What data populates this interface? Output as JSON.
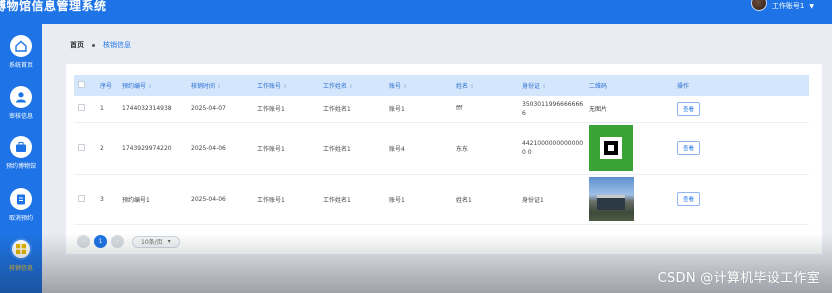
{
  "header": {
    "title": "博物馆信息管理系统",
    "user_label": "工作账号1",
    "user_caret": "▼"
  },
  "sidebar": {
    "items": [
      {
        "label": "系统首页",
        "icon": "home-icon"
      },
      {
        "label": "审核信息",
        "icon": "user-icon"
      },
      {
        "label": "预约博物馆",
        "icon": "briefcase-icon"
      },
      {
        "label": "取消预约",
        "icon": "clipboard-icon"
      },
      {
        "label": "核销信息",
        "icon": "grid-icon"
      }
    ],
    "active_index": 4
  },
  "breadcrumb": {
    "home": "首页",
    "current": "核销信息"
  },
  "table": {
    "headers": [
      "序号",
      "预约编号",
      "核销时间",
      "工作账号",
      "工作姓名",
      "账号",
      "姓名",
      "身份证",
      "二维码",
      "操作"
    ],
    "rows": [
      {
        "index": "1",
        "booking_no": "1744032314938",
        "time": "2025-04-07",
        "work_account": "工作账号1",
        "work_name": "工作姓名1",
        "account": "账号1",
        "name": "fff",
        "id_card": "35030119966666666",
        "qr": "无图片",
        "action": "查看"
      },
      {
        "index": "2",
        "booking_no": "1743929974220",
        "time": "2025-04-06",
        "work_account": "工作账号1",
        "work_name": "工作姓名1",
        "account": "账号4",
        "name": "东东",
        "id_card": "44210000000000000 0",
        "qr": "",
        "action": "查看"
      },
      {
        "index": "3",
        "booking_no": "预约编号1",
        "time": "2025-04-06",
        "work_account": "工作账号1",
        "work_name": "工作姓名1",
        "account": "账号1",
        "name": "姓名1",
        "id_card": "身份证1",
        "qr": "",
        "action": "查看"
      }
    ]
  },
  "pagination": {
    "prev": "‹",
    "page": "1",
    "next": "›",
    "size": "10条/页",
    "size_caret": "▾"
  },
  "watermark": "CSDN @计算机毕设工作室",
  "colors": {
    "primary": "#1e74e6",
    "table_header_bg": "#d4e6fb",
    "qr_green": "#3aa335"
  }
}
